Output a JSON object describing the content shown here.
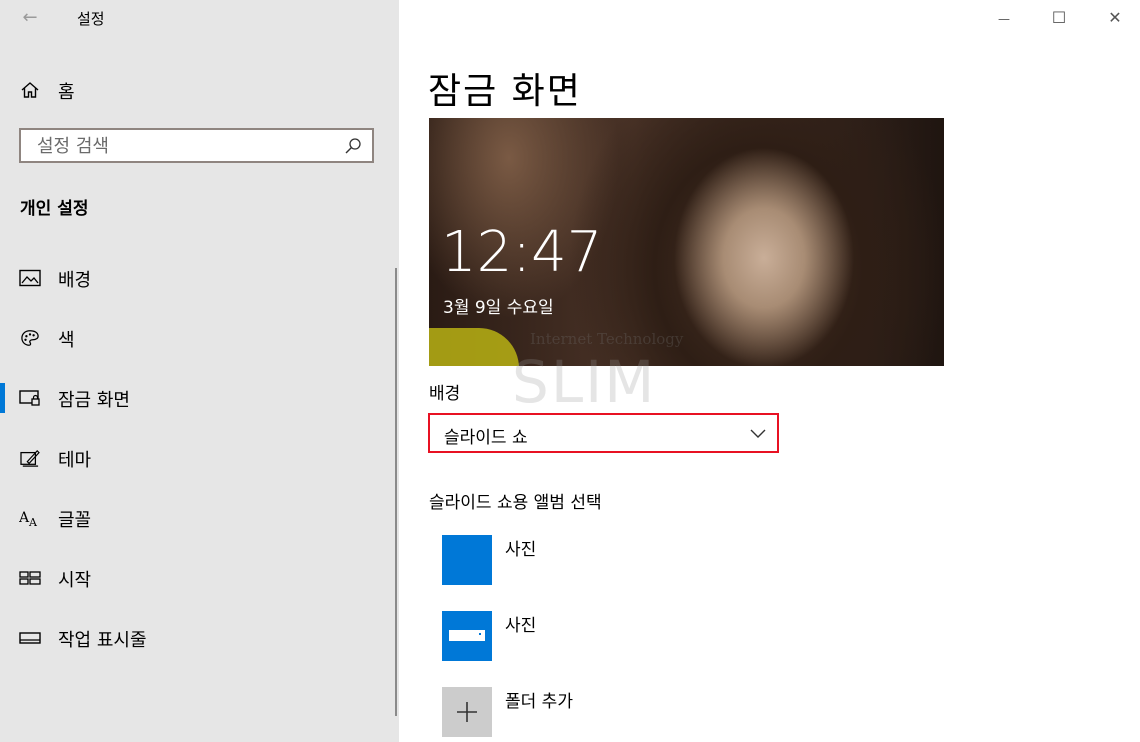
{
  "window": {
    "title": "설정",
    "back_glyph": "←",
    "minimize_glyph": "—",
    "maximize_glyph": "☐",
    "close_glyph": "✕"
  },
  "sidebar": {
    "home_label": "홈",
    "search_placeholder": "설정 검색",
    "section_title": "개인 설정",
    "items": [
      {
        "label": "배경",
        "icon": "picture-icon"
      },
      {
        "label": "색",
        "icon": "palette-icon"
      },
      {
        "label": "잠금 화면",
        "icon": "lock-screen-icon",
        "selected": true
      },
      {
        "label": "테마",
        "icon": "theme-brush-icon"
      },
      {
        "label": "글꼴",
        "icon": "font-icon"
      },
      {
        "label": "시작",
        "icon": "start-icon"
      },
      {
        "label": "작업 표시줄",
        "icon": "taskbar-icon"
      }
    ]
  },
  "main": {
    "page_title": "잠금 화면",
    "preview": {
      "time": "12:47",
      "date": "3월 9일 수요일"
    },
    "watermark": {
      "line1": "Internet Technology",
      "line2": "SLIM"
    },
    "background_label": "배경",
    "background_value": "슬라이드 쇼",
    "album_section_title": "슬라이드 쇼용 앨범 선택",
    "albums": [
      {
        "label": "사진"
      },
      {
        "label": "사진"
      },
      {
        "label": "폴더 추가"
      }
    ]
  },
  "colors": {
    "accent": "#0078d7",
    "sidebar_bg": "#e6e6e6",
    "highlight_border": "#e81123"
  }
}
